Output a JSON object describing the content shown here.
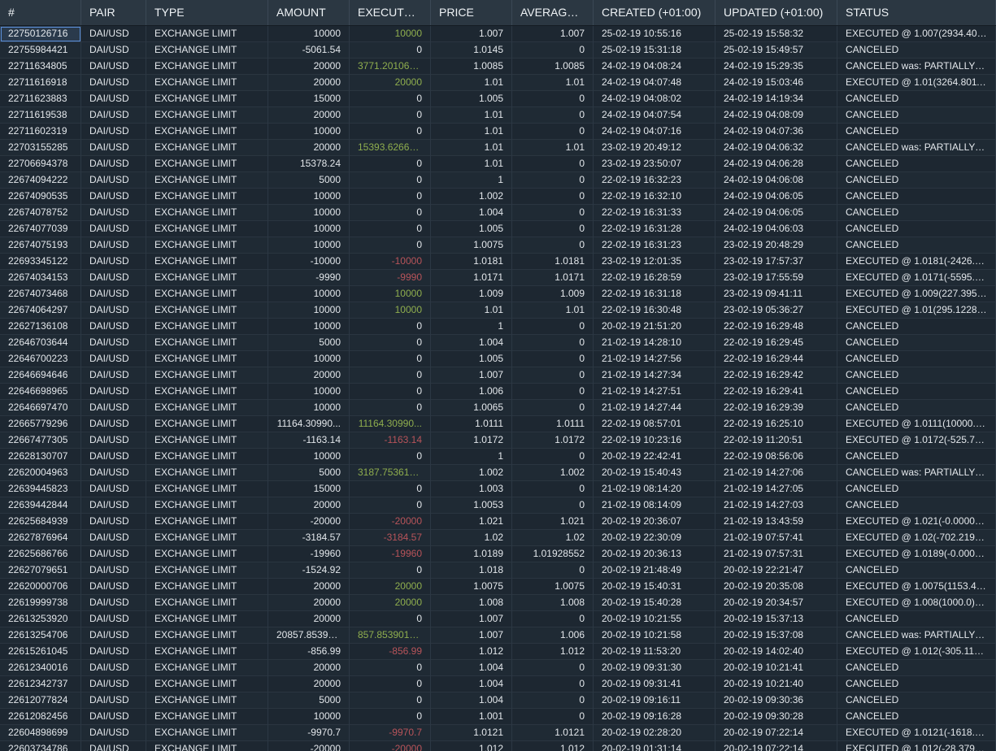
{
  "columns": [
    "#",
    "PAIR",
    "TYPE",
    "AMOUNT",
    "EXECUTED...",
    "PRICE",
    "AVERAGE ...",
    "CREATED (+01:00)",
    "UPDATED (+01:00)",
    "STATUS"
  ],
  "colors": {
    "positive": "#8fae4e",
    "negative": "#b8545a",
    "background": "#1d2731",
    "header": "#2b3742"
  },
  "rows": [
    [
      "22750126716",
      "DAI/USD",
      "EXCHANGE LIMIT",
      "10000",
      "10000",
      "1.007",
      "1.007",
      "25-02-19 10:55:16",
      "25-02-19 15:58:32",
      "EXECUTED @ 1.007(2934.4075..."
    ],
    [
      "22755984421",
      "DAI/USD",
      "EXCHANGE LIMIT",
      "-5061.54",
      "0",
      "1.0145",
      "0",
      "25-02-19 15:31:18",
      "25-02-19 15:49:57",
      "CANCELED"
    ],
    [
      "22711634805",
      "DAI/USD",
      "EXCHANGE LIMIT",
      "20000",
      "3771.201060...",
      "1.0085",
      "1.0085",
      "24-02-19 04:08:24",
      "24-02-19 15:29:35",
      "CANCELED was: PARTIALLY FIL..."
    ],
    [
      "22711616918",
      "DAI/USD",
      "EXCHANGE LIMIT",
      "20000",
      "20000",
      "1.01",
      "1.01",
      "24-02-19 04:07:48",
      "24-02-19 15:03:46",
      "EXECUTED @ 1.01(3264.80110..."
    ],
    [
      "22711623883",
      "DAI/USD",
      "EXCHANGE LIMIT",
      "15000",
      "0",
      "1.005",
      "0",
      "24-02-19 04:08:02",
      "24-02-19 14:19:34",
      "CANCELED"
    ],
    [
      "22711619538",
      "DAI/USD",
      "EXCHANGE LIMIT",
      "20000",
      "0",
      "1.01",
      "0",
      "24-02-19 04:07:54",
      "24-02-19 04:08:09",
      "CANCELED"
    ],
    [
      "22711602319",
      "DAI/USD",
      "EXCHANGE LIMIT",
      "10000",
      "0",
      "1.01",
      "0",
      "24-02-19 04:07:16",
      "24-02-19 04:07:36",
      "CANCELED"
    ],
    [
      "22703155285",
      "DAI/USD",
      "EXCHANGE LIMIT",
      "20000",
      "15393.62669...",
      "1.01",
      "1.01",
      "23-02-19 20:49:12",
      "24-02-19 04:06:32",
      "CANCELED was: PARTIALLY FIL..."
    ],
    [
      "22706694378",
      "DAI/USD",
      "EXCHANGE LIMIT",
      "15378.24",
      "0",
      "1.01",
      "0",
      "23-02-19 23:50:07",
      "24-02-19 04:06:28",
      "CANCELED"
    ],
    [
      "22674094222",
      "DAI/USD",
      "EXCHANGE LIMIT",
      "5000",
      "0",
      "1",
      "0",
      "22-02-19 16:32:23",
      "24-02-19 04:06:08",
      "CANCELED"
    ],
    [
      "22674090535",
      "DAI/USD",
      "EXCHANGE LIMIT",
      "10000",
      "0",
      "1.002",
      "0",
      "22-02-19 16:32:10",
      "24-02-19 04:06:05",
      "CANCELED"
    ],
    [
      "22674078752",
      "DAI/USD",
      "EXCHANGE LIMIT",
      "10000",
      "0",
      "1.004",
      "0",
      "22-02-19 16:31:33",
      "24-02-19 04:06:05",
      "CANCELED"
    ],
    [
      "22674077039",
      "DAI/USD",
      "EXCHANGE LIMIT",
      "10000",
      "0",
      "1.005",
      "0",
      "22-02-19 16:31:28",
      "24-02-19 04:06:03",
      "CANCELED"
    ],
    [
      "22674075193",
      "DAI/USD",
      "EXCHANGE LIMIT",
      "10000",
      "0",
      "1.0075",
      "0",
      "22-02-19 16:31:23",
      "23-02-19 20:48:29",
      "CANCELED"
    ],
    [
      "22693345122",
      "DAI/USD",
      "EXCHANGE LIMIT",
      "-10000",
      "-10000",
      "1.0181",
      "1.0181",
      "23-02-19 12:01:35",
      "23-02-19 17:57:37",
      "EXECUTED @ 1.0181(-2426.160..."
    ],
    [
      "22674034153",
      "DAI/USD",
      "EXCHANGE LIMIT",
      "-9990",
      "-9990",
      "1.0171",
      "1.0171",
      "22-02-19 16:28:59",
      "23-02-19 17:55:59",
      "EXECUTED @ 1.0171(-5595.761..."
    ],
    [
      "22674073468",
      "DAI/USD",
      "EXCHANGE LIMIT",
      "10000",
      "10000",
      "1.009",
      "1.009",
      "22-02-19 16:31:18",
      "23-02-19 09:41:11",
      "EXECUTED @ 1.009(227.39546..."
    ],
    [
      "22674064297",
      "DAI/USD",
      "EXCHANGE LIMIT",
      "10000",
      "10000",
      "1.01",
      "1.01",
      "22-02-19 16:30:48",
      "23-02-19 05:36:27",
      "EXECUTED @ 1.01(295.122846..."
    ],
    [
      "22627136108",
      "DAI/USD",
      "EXCHANGE LIMIT",
      "10000",
      "0",
      "1",
      "0",
      "20-02-19 21:51:20",
      "22-02-19 16:29:48",
      "CANCELED"
    ],
    [
      "22646703644",
      "DAI/USD",
      "EXCHANGE LIMIT",
      "5000",
      "0",
      "1.004",
      "0",
      "21-02-19 14:28:10",
      "22-02-19 16:29:45",
      "CANCELED"
    ],
    [
      "22646700223",
      "DAI/USD",
      "EXCHANGE LIMIT",
      "10000",
      "0",
      "1.005",
      "0",
      "21-02-19 14:27:56",
      "22-02-19 16:29:44",
      "CANCELED"
    ],
    [
      "22646694646",
      "DAI/USD",
      "EXCHANGE LIMIT",
      "20000",
      "0",
      "1.007",
      "0",
      "21-02-19 14:27:34",
      "22-02-19 16:29:42",
      "CANCELED"
    ],
    [
      "22646698965",
      "DAI/USD",
      "EXCHANGE LIMIT",
      "10000",
      "0",
      "1.006",
      "0",
      "21-02-19 14:27:51",
      "22-02-19 16:29:41",
      "CANCELED"
    ],
    [
      "22646697470",
      "DAI/USD",
      "EXCHANGE LIMIT",
      "10000",
      "0",
      "1.0065",
      "0",
      "21-02-19 14:27:44",
      "22-02-19 16:29:39",
      "CANCELED"
    ],
    [
      "22665779296",
      "DAI/USD",
      "EXCHANGE LIMIT",
      "11164.30990...",
      "11164.30990...",
      "1.0111",
      "1.0111",
      "22-02-19 08:57:01",
      "22-02-19 16:25:10",
      "EXECUTED @ 1.0111(10000.0): ..."
    ],
    [
      "22667477305",
      "DAI/USD",
      "EXCHANGE LIMIT",
      "-1163.14",
      "-1163.14",
      "1.0172",
      "1.0172",
      "22-02-19 10:23:16",
      "22-02-19 11:20:51",
      "EXECUTED @ 1.0172(-525.7576..."
    ],
    [
      "22628130707",
      "DAI/USD",
      "EXCHANGE LIMIT",
      "10000",
      "0",
      "1",
      "0",
      "20-02-19 22:42:41",
      "22-02-19 08:56:06",
      "CANCELED"
    ],
    [
      "22620004963",
      "DAI/USD",
      "EXCHANGE LIMIT",
      "5000",
      "3187.753618...",
      "1.002",
      "1.002",
      "20-02-19 15:40:43",
      "21-02-19 14:27:06",
      "CANCELED was: PARTIALLY FIL..."
    ],
    [
      "22639445823",
      "DAI/USD",
      "EXCHANGE LIMIT",
      "15000",
      "0",
      "1.003",
      "0",
      "21-02-19 08:14:20",
      "21-02-19 14:27:05",
      "CANCELED"
    ],
    [
      "22639442844",
      "DAI/USD",
      "EXCHANGE LIMIT",
      "20000",
      "0",
      "1.0053",
      "0",
      "21-02-19 08:14:09",
      "21-02-19 14:27:03",
      "CANCELED"
    ],
    [
      "22625684939",
      "DAI/USD",
      "EXCHANGE LIMIT",
      "-20000",
      "-20000",
      "1.021",
      "1.021",
      "20-02-19 20:36:07",
      "21-02-19 13:43:59",
      "EXECUTED @ 1.021(-0.0000051..."
    ],
    [
      "22627876964",
      "DAI/USD",
      "EXCHANGE LIMIT",
      "-3184.57",
      "-3184.57",
      "1.02",
      "1.02",
      "20-02-19 22:30:09",
      "21-02-19 07:57:41",
      "EXECUTED @ 1.02(-702.219795..."
    ],
    [
      "22625686766",
      "DAI/USD",
      "EXCHANGE LIMIT",
      "-19960",
      "-19960",
      "1.0189",
      "1.01928552",
      "20-02-19 20:36:13",
      "21-02-19 07:57:31",
      "EXECUTED @ 1.0189(-0.000005..."
    ],
    [
      "22627079651",
      "DAI/USD",
      "EXCHANGE LIMIT",
      "-1524.92",
      "0",
      "1.018",
      "0",
      "20-02-19 21:48:49",
      "20-02-19 22:21:47",
      "CANCELED"
    ],
    [
      "22620000706",
      "DAI/USD",
      "EXCHANGE LIMIT",
      "20000",
      "20000",
      "1.0075",
      "1.0075",
      "20-02-19 15:40:31",
      "20-02-19 20:35:08",
      "EXECUTED @ 1.0075(1153.416..."
    ],
    [
      "22619999738",
      "DAI/USD",
      "EXCHANGE LIMIT",
      "20000",
      "20000",
      "1.008",
      "1.008",
      "20-02-19 15:40:28",
      "20-02-19 20:34:57",
      "EXECUTED @ 1.008(1000.0): wa..."
    ],
    [
      "22613253920",
      "DAI/USD",
      "EXCHANGE LIMIT",
      "20000",
      "0",
      "1.007",
      "0",
      "20-02-19 10:21:55",
      "20-02-19 15:37:13",
      "CANCELED"
    ],
    [
      "22613254706",
      "DAI/USD",
      "EXCHANGE LIMIT",
      "20857.85390...",
      "857.8539015...",
      "1.007",
      "1.006",
      "20-02-19 10:21:58",
      "20-02-19 15:37:08",
      "CANCELED was: PARTIALLY FIL..."
    ],
    [
      "22615261045",
      "DAI/USD",
      "EXCHANGE LIMIT",
      "-856.99",
      "-856.99",
      "1.012",
      "1.012",
      "20-02-19 11:53:20",
      "20-02-19 14:02:40",
      "EXECUTED @ 1.012(-305.11667..."
    ],
    [
      "22612340016",
      "DAI/USD",
      "EXCHANGE LIMIT",
      "20000",
      "0",
      "1.004",
      "0",
      "20-02-19 09:31:30",
      "20-02-19 10:21:41",
      "CANCELED"
    ],
    [
      "22612342737",
      "DAI/USD",
      "EXCHANGE LIMIT",
      "20000",
      "0",
      "1.004",
      "0",
      "20-02-19 09:31:41",
      "20-02-19 10:21:40",
      "CANCELED"
    ],
    [
      "22612077824",
      "DAI/USD",
      "EXCHANGE LIMIT",
      "5000",
      "0",
      "1.004",
      "0",
      "20-02-19 09:16:11",
      "20-02-19 09:30:36",
      "CANCELED"
    ],
    [
      "22612082456",
      "DAI/USD",
      "EXCHANGE LIMIT",
      "10000",
      "0",
      "1.001",
      "0",
      "20-02-19 09:16:28",
      "20-02-19 09:30:28",
      "CANCELED"
    ],
    [
      "22604898699",
      "DAI/USD",
      "EXCHANGE LIMIT",
      "-9970.7",
      "-9970.7",
      "1.0121",
      "1.0121",
      "20-02-19 02:28:20",
      "20-02-19 07:22:14",
      "EXECUTED @ 1.0121(-1618.091..."
    ],
    [
      "22603734786",
      "DAI/USD",
      "EXCHANGE LIMIT",
      "-20000",
      "-20000",
      "1.012",
      "1.012",
      "20-02-19 01:31:14",
      "20-02-19 07:22:14",
      "EXECUTED @ 1.012(-28.379626..."
    ]
  ]
}
